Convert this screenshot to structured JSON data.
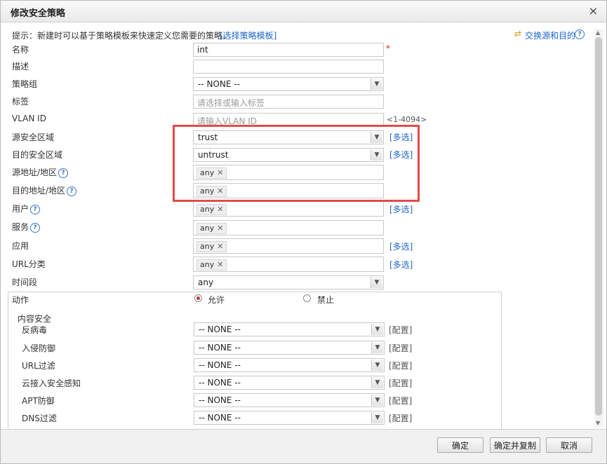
{
  "dialog": {
    "title": "修改安全策略",
    "close": "×"
  },
  "hint": {
    "text": "提示：新建时可以基于策略模板来快速定义您需要的策略。",
    "template_link": "[选择策略模板]"
  },
  "swap": {
    "label": "交换源和目的"
  },
  "help_glyph": "?",
  "fields": {
    "name": {
      "label": "名称",
      "value": "int",
      "required_mark": "*"
    },
    "desc": {
      "label": "描述",
      "value": ""
    },
    "group": {
      "label": "策略组",
      "value": "-- NONE --"
    },
    "tag": {
      "label": "标签",
      "placeholder": "请选择或输入标签"
    },
    "vlan": {
      "label": "VLAN ID",
      "placeholder": "请输入VLAN ID",
      "range": "<1-4094>"
    },
    "src_zone": {
      "label": "源安全区域",
      "value": "trust",
      "multi": "[多选]"
    },
    "dst_zone": {
      "label": "目的安全区域",
      "value": "untrust",
      "multi": "[多选]"
    },
    "src_addr": {
      "label": "源地址/地区",
      "tag": "any"
    },
    "dst_addr": {
      "label": "目的地址/地区",
      "tag": "any"
    },
    "user": {
      "label": "用户",
      "tag": "any",
      "multi": "[多选]"
    },
    "service": {
      "label": "服务",
      "tag": "any"
    },
    "app": {
      "label": "应用",
      "tag": "any",
      "multi": "[多选]"
    },
    "url": {
      "label": "URL分类",
      "tag": "any",
      "multi": "[多选]"
    },
    "time": {
      "label": "时间段",
      "value": "any"
    },
    "action": {
      "label": "动作",
      "options": [
        "允许",
        "禁止"
      ],
      "selected": "允许"
    }
  },
  "content_security": {
    "legend": "内容安全",
    "config_label": "[配置]",
    "rows": [
      {
        "label": "反病毒",
        "value": "-- NONE --"
      },
      {
        "label": "入侵防御",
        "value": "-- NONE --"
      },
      {
        "label": "URL过滤",
        "value": "-- NONE --"
      },
      {
        "label": "云接入安全感知",
        "value": "-- NONE --"
      },
      {
        "label": "APT防御",
        "value": "-- NONE --"
      },
      {
        "label": "DNS过滤",
        "value": "-- NONE --"
      }
    ]
  },
  "footer": {
    "ok": "确定",
    "ok_copy": "确定并复制",
    "cancel": "取消"
  },
  "colors": {
    "link": "#1e64c8",
    "highlight_box": "#e24b4b",
    "required": "#e02020"
  }
}
